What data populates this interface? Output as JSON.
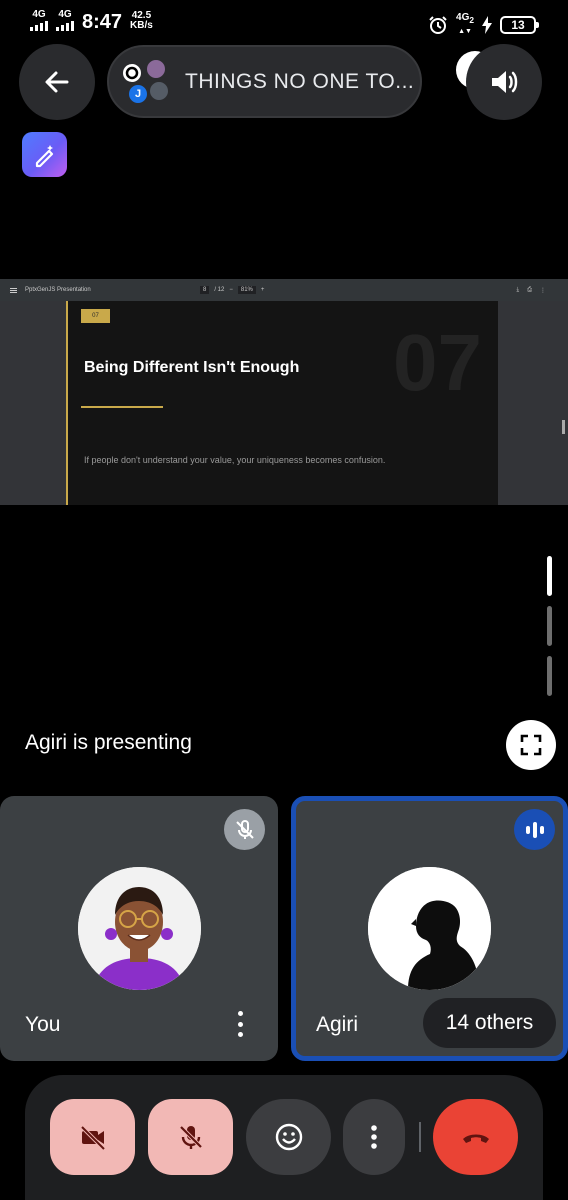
{
  "status_bar": {
    "net1": "4G",
    "net2": "4G",
    "time": "8:47",
    "speed_value": "42.5",
    "speed_unit": "KB/s",
    "net3": "4G",
    "net3_sub": "2",
    "battery": "13"
  },
  "header": {
    "meeting_title": "THINGS NO ONE TO...",
    "avatar_initial": "J"
  },
  "presentation": {
    "app_name": "PptxGenJS Presentation",
    "page_current": "8",
    "page_total": "/ 12",
    "zoom": "81%",
    "slide_number_badge": "07",
    "slide_big_number": "07",
    "slide_title": "Being Different Isn't Enough",
    "slide_body": "If people don't understand your value, your uniqueness becomes confusion."
  },
  "stage": {
    "presenting_label": "Agiri is presenting"
  },
  "tiles": {
    "you_name": "You",
    "agiri_name": "Agiri",
    "others_label": "14 others"
  },
  "colors": {
    "accent_blue": "#1a4fb5",
    "end_call_red": "#ea4335",
    "muted_pink": "#f2b8b5",
    "slide_gold": "#c9a94a"
  },
  "icons": {
    "back": "arrow-left-icon",
    "sound": "speaker-icon",
    "gemini": "magic-pen-icon",
    "fullscreen": "fullscreen-icon",
    "mic_off": "mic-off-icon",
    "speaking": "audio-wave-icon",
    "camera_off": "camera-off-icon",
    "emoji": "emoji-icon",
    "more": "more-vertical-icon",
    "end_call": "end-call-icon"
  }
}
